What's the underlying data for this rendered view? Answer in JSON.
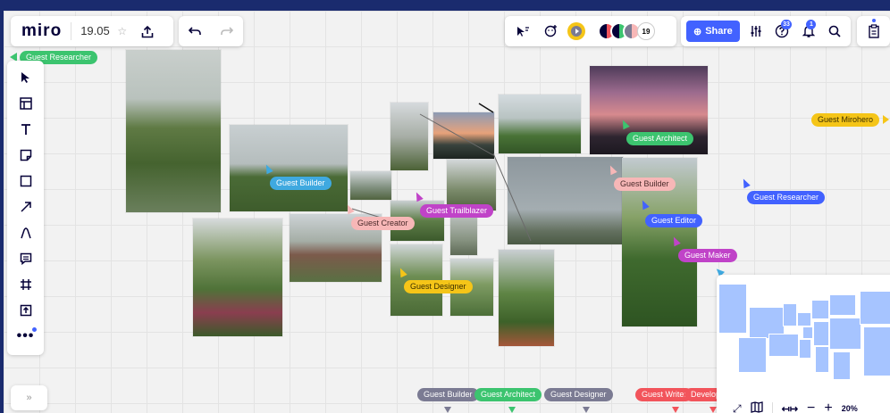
{
  "app": {
    "logo": "miro",
    "board_name": "19.05"
  },
  "header": {
    "share_label": "Share",
    "collaborators_count": "19",
    "help_badge": "33",
    "notifications_badge": "1"
  },
  "colors": {
    "accent": "#4262ff",
    "top_bar": "#1a2b6e"
  },
  "toolbar": {
    "tools": [
      "select-icon",
      "frame-template-icon",
      "text-icon",
      "sticky-note-icon",
      "shape-icon",
      "connector-arrow-icon",
      "pen-icon",
      "comment-icon",
      "frame-icon",
      "upload-icon",
      "more-icon"
    ],
    "expand_label": "»"
  },
  "cursors": [
    {
      "name": "Guest Researcher",
      "color": "#3cc46f"
    },
    {
      "name": "Guest Builder",
      "color": "#3fa9e0"
    },
    {
      "name": "Guest Creator",
      "color": "#f7b7b7"
    },
    {
      "name": "Guest Trailblazer",
      "color": "#c043c8"
    },
    {
      "name": "Guest Designer",
      "color": "#f5c518"
    },
    {
      "name": "Guest Architect",
      "color": "#3cc46f"
    },
    {
      "name": "Guest Builder",
      "color": "#f7b7b7"
    },
    {
      "name": "Guest Editor",
      "color": "#4262ff"
    },
    {
      "name": "Guest Maker",
      "color": "#c043c8"
    },
    {
      "name": "Guest Researcher",
      "color": "#4262ff"
    },
    {
      "name": "Guest Mirohero",
      "color": "#f5c518"
    }
  ],
  "offscreen_cursors": [
    {
      "name": "Guest Builder",
      "color": "#7b7b93"
    },
    {
      "name": "Guest Architect",
      "color": "#3cc46f"
    },
    {
      "name": "Guest Designer",
      "color": "#7b7b93"
    },
    {
      "name": "Guest Writer",
      "color": "#f2545b"
    },
    {
      "name": "Develop",
      "color": "#f2545b"
    }
  ],
  "minimap": {
    "zoom": "20%"
  }
}
